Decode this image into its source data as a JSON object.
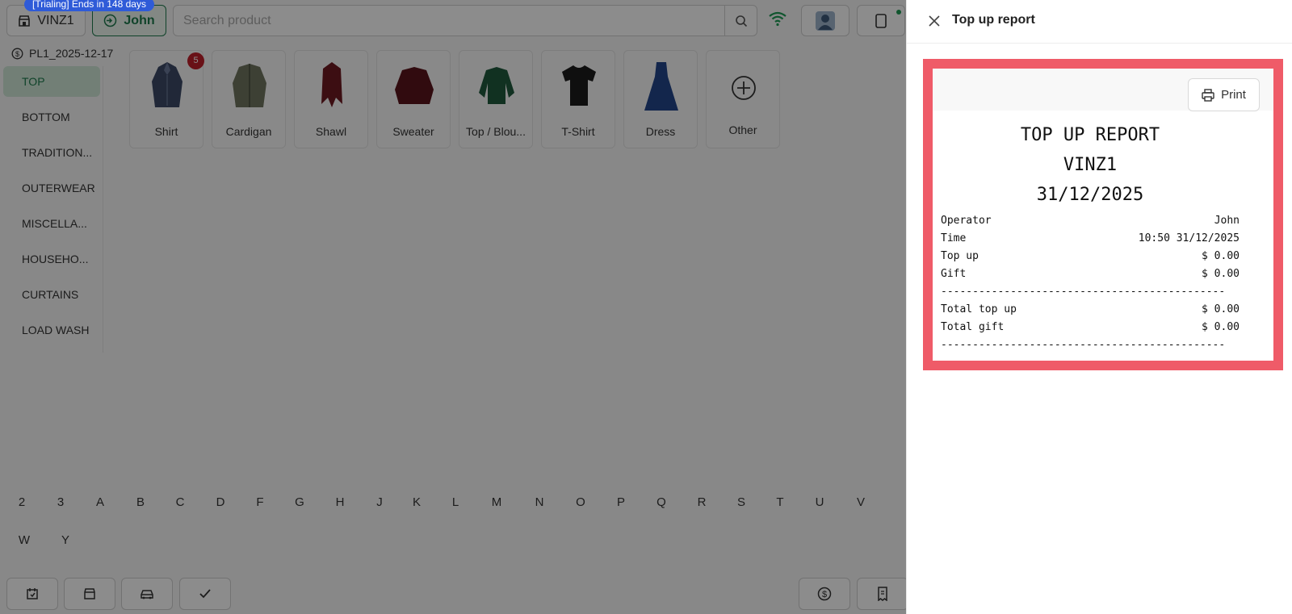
{
  "topbar": {
    "store_name": "VINZ1",
    "trial_badge": "[Trialing] Ends in 148 days",
    "user_name": "John",
    "search_placeholder": "Search product"
  },
  "price_list": "PL1_2025-12-17",
  "categories": [
    {
      "label": "TOP",
      "active": true
    },
    {
      "label": "BOTTOM"
    },
    {
      "label": "TRADITION..."
    },
    {
      "label": "OUTERWEAR"
    },
    {
      "label": "MISCELLA..."
    },
    {
      "label": "HOUSEHO..."
    },
    {
      "label": "CURTAINS"
    },
    {
      "label": "LOAD WASH"
    }
  ],
  "products": [
    {
      "label": "Shirt",
      "icon": "shirt-icon",
      "badge": "5",
      "color": "#3d4a66"
    },
    {
      "label": "Cardigan",
      "icon": "cardigan-icon",
      "color": "#6f7560"
    },
    {
      "label": "Shawl",
      "icon": "shawl-icon",
      "color": "#6d1a22"
    },
    {
      "label": "Sweater",
      "icon": "sweater-icon",
      "color": "#5a141c"
    },
    {
      "label": "Top / Blou...",
      "icon": "blouse-icon",
      "color": "#1f5a3c"
    },
    {
      "label": "T-Shirt",
      "icon": "tshirt-icon",
      "color": "#1c1c1c"
    },
    {
      "label": "Dress",
      "icon": "dress-icon",
      "color": "#23468a"
    },
    {
      "label": "Other",
      "icon": "plus-circle-icon"
    }
  ],
  "alphabet_row1": [
    "2",
    "3",
    "A",
    "B",
    "C",
    "D",
    "F",
    "G",
    "H",
    "J",
    "K",
    "L",
    "M",
    "N",
    "O",
    "P",
    "Q",
    "R",
    "S",
    "T",
    "U",
    "V"
  ],
  "alphabet_row2": [
    "W",
    "Y"
  ],
  "drawer": {
    "title": "Top up report",
    "print_label": "Print",
    "report": {
      "title": "TOP UP REPORT",
      "store": "VINZ1",
      "date": "31/12/2025",
      "rows": [
        {
          "label": "Operator",
          "value": "John"
        },
        {
          "label": "Time",
          "value": "10:50 31/12/2025"
        },
        {
          "label": "Top up",
          "value": "$ 0.00"
        },
        {
          "label": "Gift",
          "value": "$ 0.00"
        }
      ],
      "separator": "---------------------------------------------",
      "totals": [
        {
          "label": "Total top up",
          "value": "$ 0.00"
        },
        {
          "label": "Total gift",
          "value": "$ 0.00"
        }
      ]
    }
  },
  "colors": {
    "accent_green": "#1e7a4d",
    "trial_blue": "#2f5bd8",
    "highlight_red": "#ef5b68",
    "badge_red": "#c0202a"
  }
}
